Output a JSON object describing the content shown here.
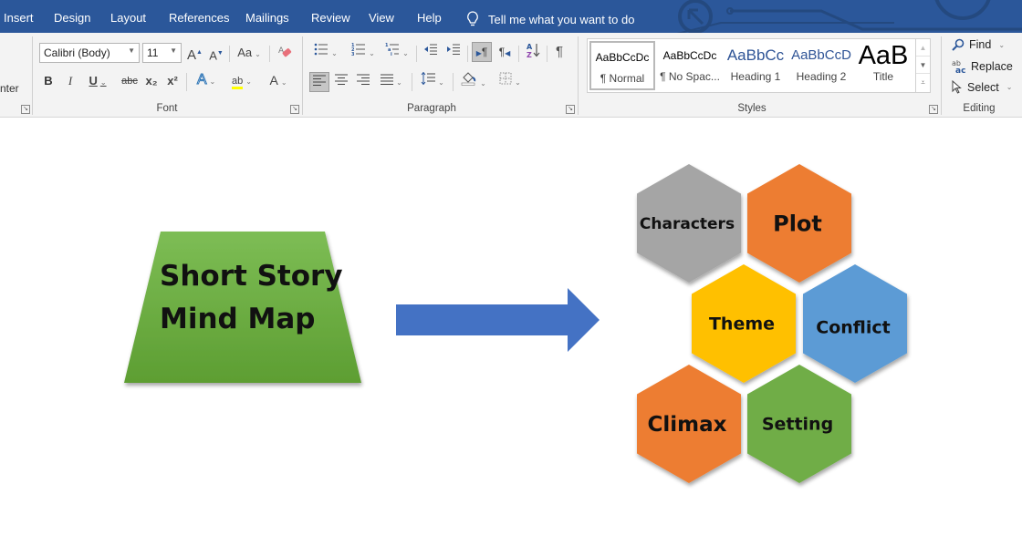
{
  "ribbon_tabs": [
    "Insert",
    "Design",
    "Layout",
    "References",
    "Mailings",
    "Review",
    "View",
    "Help"
  ],
  "tell_me": "Tell me what you want to do",
  "clipboard_partial_label": "nter",
  "font_group": {
    "label": "Font",
    "font_name": "Calibri (Body)",
    "font_size": "11",
    "grow_font": "A",
    "shrink_font": "A",
    "change_case": "Aa",
    "bold": "B",
    "italic": "I",
    "underline": "U",
    "strikethrough": "abc",
    "subscript": "x₂",
    "superscript": "x²",
    "text_effects": "A",
    "highlight": "ab",
    "font_color": "A"
  },
  "paragraph_group": {
    "label": "Paragraph",
    "pilcrow": "¶"
  },
  "styles_group": {
    "label": "Styles",
    "items": [
      {
        "preview": "AaBbCcDc",
        "name": "¶ Normal"
      },
      {
        "preview": "AaBbCcDc",
        "name": "¶ No Spac..."
      },
      {
        "preview": "AaBbCc",
        "name": "Heading 1"
      },
      {
        "preview": "AaBbCcD",
        "name": "Heading 2"
      },
      {
        "preview": "AaB",
        "name": "Title"
      }
    ]
  },
  "editing_group": {
    "label": "Editing",
    "find": "Find",
    "replace": "Replace",
    "select": "Select"
  },
  "document": {
    "title_shape": {
      "line1": "Short Story",
      "line2": "Mind Map",
      "color": "#6aab3f"
    },
    "arrow_color": "#4472c4",
    "hexagons": [
      {
        "label": "Characters",
        "color": "#a5a5a5"
      },
      {
        "label": "Plot",
        "color": "#ed7d31"
      },
      {
        "label": "Theme",
        "color": "#ffc000"
      },
      {
        "label": "Conflict",
        "color": "#5b9bd5"
      },
      {
        "label": "Climax",
        "color": "#ed7d31"
      },
      {
        "label": "Setting",
        "color": "#70ad47"
      }
    ]
  }
}
